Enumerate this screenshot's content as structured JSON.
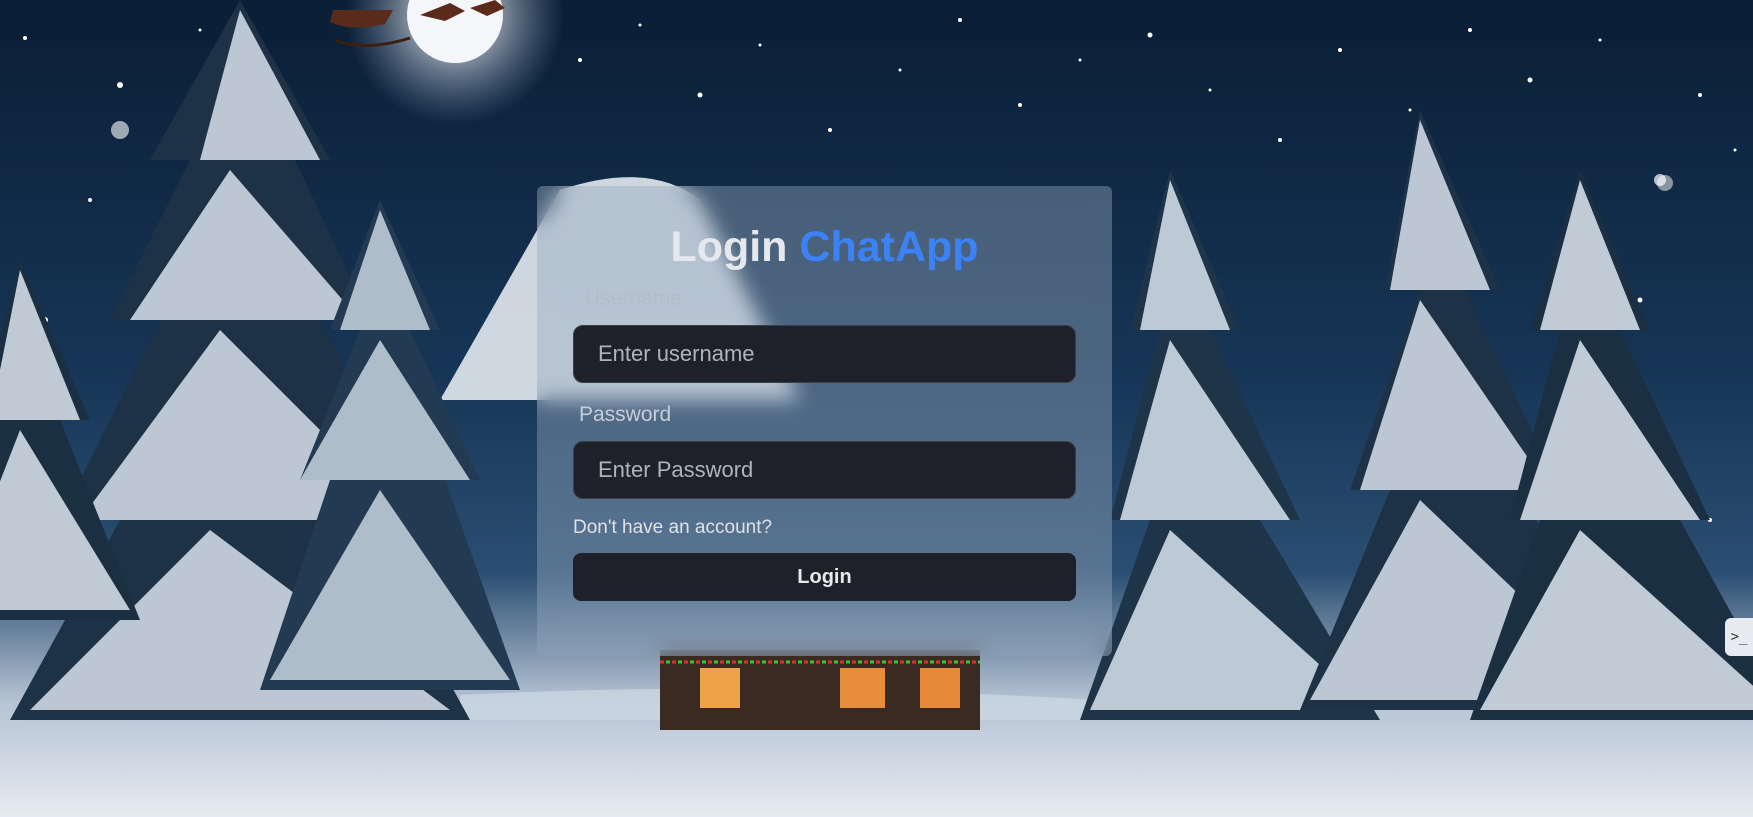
{
  "login": {
    "title_main": "Login",
    "title_brand": "ChatApp",
    "username_label": "Username",
    "username_placeholder": "Enter username",
    "password_label": "Password",
    "password_placeholder": "Enter Password",
    "signup_link": "Don't have an account?",
    "submit_label": "Login"
  },
  "side_tab": {
    "icon": "terminal-icon"
  },
  "colors": {
    "brand": "#3b82f6",
    "input_bg": "#1e2129",
    "button_bg": "#1e2129",
    "night_sky": "#0a1e35"
  }
}
